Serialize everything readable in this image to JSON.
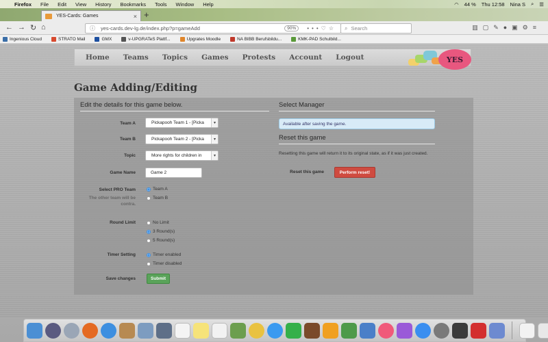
{
  "os": {
    "menubar": [
      "Firefox",
      "File",
      "Edit",
      "View",
      "History",
      "Bookmarks",
      "Tools",
      "Window",
      "Help"
    ],
    "battery": "44 %",
    "clock": "Thu 12:58",
    "user": "Nina S"
  },
  "browser": {
    "tab_title": "YES-Cards: Games",
    "url": "yes-cards.dev-lg.de/index.php?p=gameAdd",
    "zoom": "90%",
    "search_placeholder": "Search",
    "bookmarks": [
      "Ingenious Cloud",
      "STRATO Mail",
      "GMX",
      "v-UPGRATeS Plattf...",
      "Upgrates Moodle",
      "NA BIBB Berufsbildu...",
      "KMK-PAD Schulbild..."
    ]
  },
  "site": {
    "nav": [
      "Home",
      "Teams",
      "Topics",
      "Games",
      "Protests",
      "Account",
      "Logout"
    ],
    "logo_text": "YES",
    "page_title": "Game Adding/Editing"
  },
  "form": {
    "section_title": "Edit the details for this game below.",
    "team_a_label": "Team A",
    "team_a_value": "Pickapooh Team 1 - [Picka",
    "team_b_label": "Team B",
    "team_b_value": "Pickapooh Team 2 - [Picka",
    "topic_label": "Topic",
    "topic_value": "More rights for children in",
    "game_name_label": "Game Name",
    "game_name_value": "Game 2",
    "pro_team_label": "Select PRO Team",
    "pro_team_hint": "The other team will be contra.",
    "pro_team_options": [
      "Team A",
      "Team B"
    ],
    "round_limit_label": "Round Limit",
    "round_limit_options": [
      "No Limit",
      "3 Round(s)",
      "5 Round(s)"
    ],
    "timer_label": "Timer Setting",
    "timer_options": [
      "Timer enabled",
      "Timer disabled"
    ],
    "save_label": "Save changes",
    "submit_label": "Submit"
  },
  "manager": {
    "title": "Select Manager",
    "notice": "Available after saving the game."
  },
  "reset": {
    "title": "Reset this game",
    "description": "Resetting this game will return it to its original state, as if it was just created.",
    "label": "Reset this game",
    "button": "Perform reset!"
  }
}
